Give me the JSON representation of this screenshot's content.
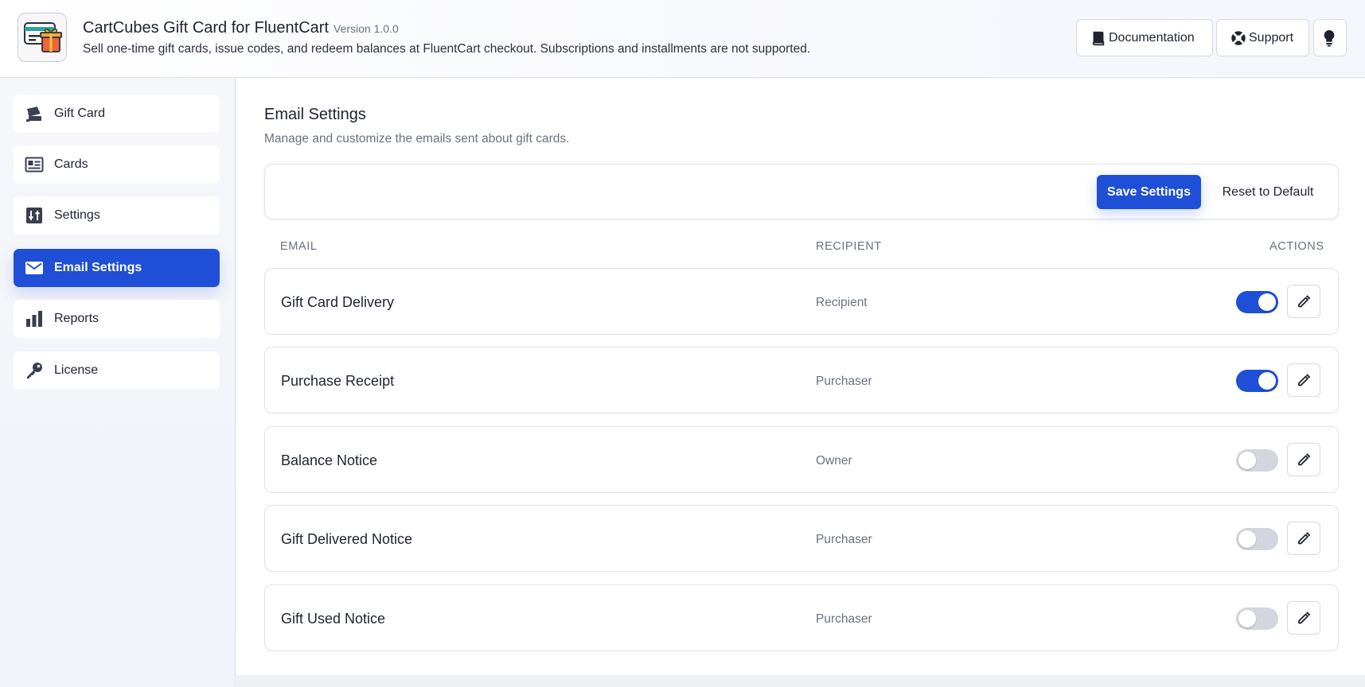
{
  "header": {
    "title": "CartCubes Gift Card for FluentCart",
    "version": "Version 1.0.0",
    "description": "Sell one-time gift cards, issue codes, and redeem balances at FluentCart checkout. Subscriptions and installments are not supported.",
    "documentation_label": "Documentation",
    "support_label": "Support"
  },
  "sidebar": {
    "items": [
      {
        "label": "Gift Card",
        "icon": "gift-card-icon",
        "active": false
      },
      {
        "label": "Cards",
        "icon": "cards-icon",
        "active": false
      },
      {
        "label": "Settings",
        "icon": "settings-icon",
        "active": false
      },
      {
        "label": "Email Settings",
        "icon": "mail-icon",
        "active": true
      },
      {
        "label": "Reports",
        "icon": "bar-chart-icon",
        "active": false
      },
      {
        "label": "License",
        "icon": "key-icon",
        "active": false
      }
    ]
  },
  "main": {
    "title": "Email Settings",
    "subtitle": "Manage and customize the emails sent about gift cards.",
    "save_label": "Save Settings",
    "reset_label": "Reset to Default",
    "columns": {
      "email": "EMAIL",
      "recipient": "RECIPIENT",
      "actions": "ACTIONS"
    },
    "rows": [
      {
        "name": "Gift Card Delivery",
        "recipient": "Recipient",
        "enabled": true
      },
      {
        "name": "Purchase Receipt",
        "recipient": "Purchaser",
        "enabled": true
      },
      {
        "name": "Balance Notice",
        "recipient": "Owner",
        "enabled": false
      },
      {
        "name": "Gift Delivered Notice",
        "recipient": "Purchaser",
        "enabled": false
      },
      {
        "name": "Gift Used Notice",
        "recipient": "Purchaser",
        "enabled": false
      }
    ]
  },
  "colors": {
    "accent": "#1e4fd6",
    "toggle_off": "#d3d6de"
  }
}
